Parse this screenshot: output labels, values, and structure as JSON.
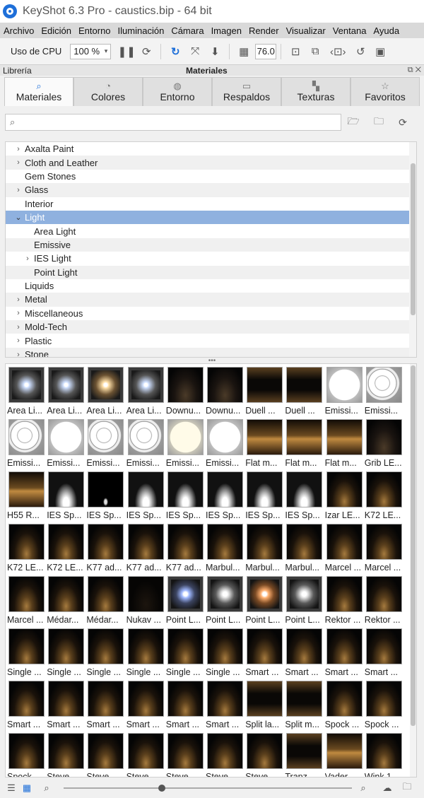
{
  "window": {
    "title": "KeyShot 6.3 Pro  - caustics.bip  - 64 bit"
  },
  "menu": [
    "Archivo",
    "Edición",
    "Entorno",
    "Iluminación",
    "Cámara",
    "Imagen",
    "Render",
    "Visualizar",
    "Ventana",
    "Ayuda"
  ],
  "toolbar": {
    "cpu_label": "Uso de CPU",
    "cpu_value": "100 %",
    "fov_value": "76.0"
  },
  "panel": {
    "library_label": "Librería",
    "title": "Materiales",
    "controls": "⧉ ✕"
  },
  "tabs": [
    {
      "label": "Materiales",
      "icon": "material-icon",
      "glyph": "⌕"
    },
    {
      "label": "Colores",
      "icon": "palette-icon",
      "glyph": "◔"
    },
    {
      "label": "Entorno",
      "icon": "globe-icon",
      "glyph": "◍"
    },
    {
      "label": "Respaldos",
      "icon": "image-icon",
      "glyph": "▭"
    },
    {
      "label": "Texturas",
      "icon": "checker-icon",
      "glyph": "▚"
    },
    {
      "label": "Favoritos",
      "icon": "star-icon",
      "glyph": "☆"
    }
  ],
  "search": {
    "placeholder": "",
    "icon": "⌕"
  },
  "tree": [
    {
      "label": "Axalta Paint",
      "chevron": "›",
      "indent": 0
    },
    {
      "label": "Cloth and Leather",
      "chevron": "›",
      "indent": 0
    },
    {
      "label": "Gem Stones",
      "chevron": "",
      "indent": 0
    },
    {
      "label": "Glass",
      "chevron": "›",
      "indent": 0
    },
    {
      "label": "Interior",
      "chevron": "",
      "indent": 0
    },
    {
      "label": "Light",
      "chevron": "⌄",
      "indent": 0,
      "selected": true
    },
    {
      "label": "Area Light",
      "chevron": "",
      "indent": 1
    },
    {
      "label": "Emissive",
      "chevron": "",
      "indent": 1
    },
    {
      "label": "IES Light",
      "chevron": "›",
      "indent": 1
    },
    {
      "label": "Point Light",
      "chevron": "",
      "indent": 1
    },
    {
      "label": "Liquids",
      "chevron": "",
      "indent": 0
    },
    {
      "label": "Metal",
      "chevron": "›",
      "indent": 0
    },
    {
      "label": "Miscellaneous",
      "chevron": "›",
      "indent": 0
    },
    {
      "label": "Mold-Tech",
      "chevron": "›",
      "indent": 0
    },
    {
      "label": "Plastic",
      "chevron": "›",
      "indent": 0
    },
    {
      "label": "Stone",
      "chevron": "›",
      "indent": 0
    }
  ],
  "splitter_glyph": "•••",
  "materials": [
    {
      "label": "Area Li...",
      "kind": "cool"
    },
    {
      "label": "Area Li...",
      "kind": "cool"
    },
    {
      "label": "Area Li...",
      "kind": "warm"
    },
    {
      "label": "Area Li...",
      "kind": "cool"
    },
    {
      "label": "Downu...",
      "kind": "dim"
    },
    {
      "label": "Downu...",
      "kind": "dim"
    },
    {
      "label": "Duell ...",
      "kind": "hour"
    },
    {
      "label": "Duell ...",
      "kind": "hour"
    },
    {
      "label": "Emissi...",
      "kind": "whiteball"
    },
    {
      "label": "Emissi...",
      "kind": "patchy"
    },
    {
      "label": "Emissi...",
      "kind": "patchy"
    },
    {
      "label": "Emissi...",
      "kind": "whiteball"
    },
    {
      "label": "Emissi...",
      "kind": "patchy"
    },
    {
      "label": "Emissi...",
      "kind": "patchy"
    },
    {
      "label": "Emissi...",
      "kind": "cream"
    },
    {
      "label": "Emissi...",
      "kind": "whiteball"
    },
    {
      "label": "Flat m...",
      "kind": "flat"
    },
    {
      "label": "Flat m...",
      "kind": "flat"
    },
    {
      "label": "Flat m...",
      "kind": "flat"
    },
    {
      "label": "Grib LE...",
      "kind": "dim"
    },
    {
      "label": "H55 R...",
      "kind": "flat"
    },
    {
      "label": "IES Sp...",
      "kind": "spotw"
    },
    {
      "label": "IES Sp...",
      "kind": "tiny"
    },
    {
      "label": "IES Sp...",
      "kind": "spotw"
    },
    {
      "label": "IES Sp...",
      "kind": "spotw"
    },
    {
      "label": "IES Sp...",
      "kind": "spotw"
    },
    {
      "label": "IES Sp...",
      "kind": "spotw"
    },
    {
      "label": "IES Sp...",
      "kind": "spotw"
    },
    {
      "label": "Izar LE...",
      "kind": "cone"
    },
    {
      "label": "K72 LE...",
      "kind": "cone"
    },
    {
      "label": "K72 LE...",
      "kind": "cone"
    },
    {
      "label": "K72 LE...",
      "kind": "cone"
    },
    {
      "label": "K77 ad...",
      "kind": "cone"
    },
    {
      "label": "K77 ad...",
      "kind": "cone"
    },
    {
      "label": "K77 ad...",
      "kind": "cone"
    },
    {
      "label": "Marbul...",
      "kind": "cone"
    },
    {
      "label": "Marbul...",
      "kind": "cone"
    },
    {
      "label": "Marbul...",
      "kind": "cone"
    },
    {
      "label": "Marcel ...",
      "kind": "cone"
    },
    {
      "label": "Marcel ...",
      "kind": "cone"
    },
    {
      "label": "Marcel ...",
      "kind": "cone"
    },
    {
      "label": "Médar...",
      "kind": "cone"
    },
    {
      "label": "Médar...",
      "kind": "cone"
    },
    {
      "label": "Nukav ...",
      "kind": "dark"
    },
    {
      "label": "Point L...",
      "kind": "pointcool"
    },
    {
      "label": "Point L...",
      "kind": "pointwhite"
    },
    {
      "label": "Point L...",
      "kind": "pointwarm"
    },
    {
      "label": "Point L...",
      "kind": "pointwhite"
    },
    {
      "label": "Rektor ...",
      "kind": "cone"
    },
    {
      "label": "Rektor ...",
      "kind": "cone"
    },
    {
      "label": "Single ...",
      "kind": "cone"
    },
    {
      "label": "Single ...",
      "kind": "cone"
    },
    {
      "label": "Single ...",
      "kind": "cone"
    },
    {
      "label": "Single ...",
      "kind": "cone"
    },
    {
      "label": "Single ...",
      "kind": "cone"
    },
    {
      "label": "Single ...",
      "kind": "cone"
    },
    {
      "label": "Smart ...",
      "kind": "cone"
    },
    {
      "label": "Smart ...",
      "kind": "cone"
    },
    {
      "label": "Smart ...",
      "kind": "cone"
    },
    {
      "label": "Smart ...",
      "kind": "cone"
    },
    {
      "label": "Smart ...",
      "kind": "cone"
    },
    {
      "label": "Smart ...",
      "kind": "cone"
    },
    {
      "label": "Smart ...",
      "kind": "cone"
    },
    {
      "label": "Smart ...",
      "kind": "cone"
    },
    {
      "label": "Smart ...",
      "kind": "cone"
    },
    {
      "label": "Smart ...",
      "kind": "cone"
    },
    {
      "label": "Split la...",
      "kind": "hour"
    },
    {
      "label": "Split m...",
      "kind": "hour"
    },
    {
      "label": "Spock ...",
      "kind": "cone"
    },
    {
      "label": "Spock ...",
      "kind": "cone"
    },
    {
      "label": "Spock ...",
      "kind": "cone"
    },
    {
      "label": "Steve ...",
      "kind": "cone"
    },
    {
      "label": "Steve ...",
      "kind": "cone"
    },
    {
      "label": "Steve ...",
      "kind": "cone"
    },
    {
      "label": "Steve ...",
      "kind": "cone"
    },
    {
      "label": "Steve ...",
      "kind": "cone"
    },
    {
      "label": "Steve ...",
      "kind": "cone"
    },
    {
      "label": "Trapz ...",
      "kind": "hour"
    },
    {
      "label": "Vader ...",
      "kind": "flat"
    },
    {
      "label": "Wink 1...",
      "kind": "cone"
    }
  ],
  "zoom_fraction": 0.34,
  "colors": {
    "accent": "#1e6fd9",
    "selection": "#8fb1df"
  }
}
